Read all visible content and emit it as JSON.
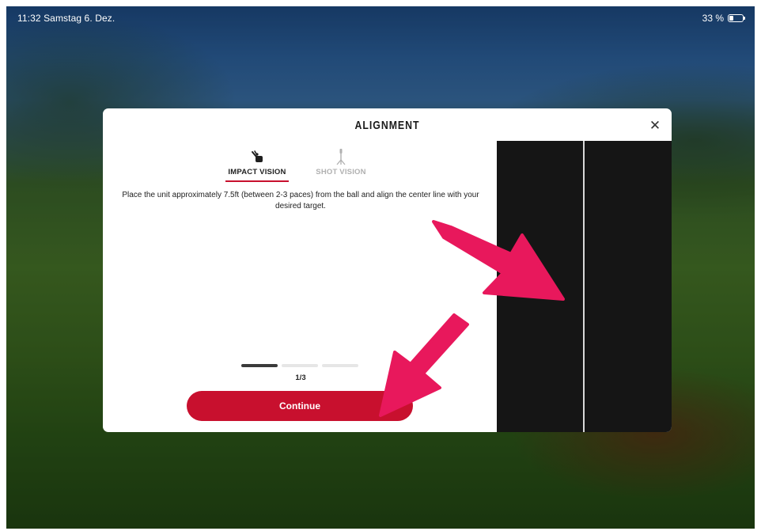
{
  "status_bar": {
    "time_date": "11:32  Samstag 6. Dez.",
    "battery_percent": "33 %",
    "battery_level": 0.33
  },
  "modal": {
    "title": "ALIGNMENT",
    "close_icon": "close-icon",
    "tabs": [
      {
        "label": "IMPACT VISION",
        "icon": "impact-vision-icon",
        "active": true
      },
      {
        "label": "SHOT VISION",
        "icon": "tripod-icon",
        "active": false
      }
    ],
    "instruction": "Place the unit approximately 7.5ft (between 2-3 paces) from the ball and align the center line with your desired target.",
    "progress": {
      "current": 1,
      "total": 3,
      "label": "1/3"
    },
    "continue_label": "Continue"
  },
  "colors": {
    "accent": "#c8102e",
    "annotation_arrow": "#e8185c",
    "camera_background": "#151515"
  }
}
